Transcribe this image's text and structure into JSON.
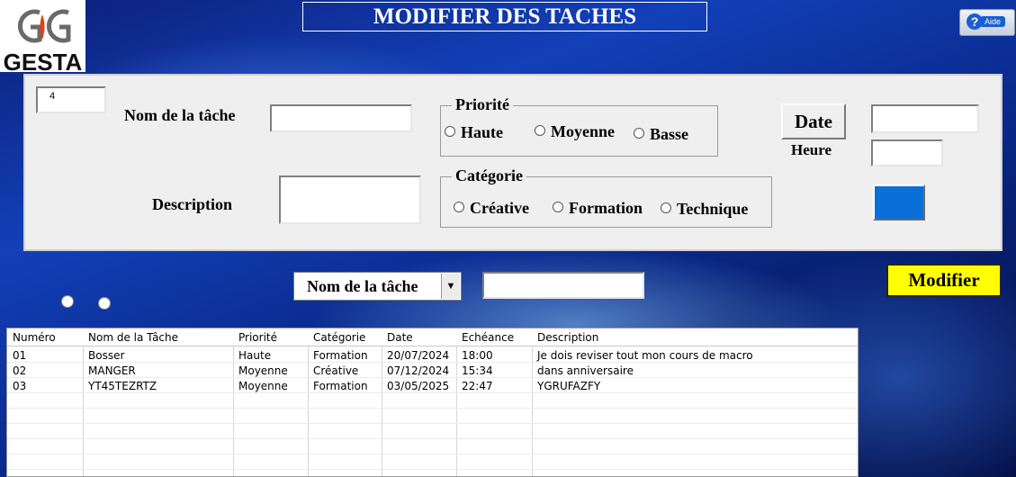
{
  "app": {
    "brand": "GESTA",
    "title": "MODIFIER DES TACHES",
    "help_label": "Aide"
  },
  "form": {
    "id_value": "4",
    "task_name_label": "Nom de la tâche",
    "task_name_value": "",
    "description_label": "Description",
    "description_value": "",
    "priority": {
      "legend": "Priorité",
      "options": [
        "Haute",
        "Moyenne",
        "Basse"
      ]
    },
    "category": {
      "legend": "Catégorie",
      "options": [
        "Créative",
        "Formation",
        "Technique"
      ]
    },
    "date_button_label": "Date",
    "date_value": "",
    "time_label": "Heure",
    "time_value": "",
    "color_swatch": "#0a6fd8"
  },
  "search": {
    "field_selected": "Nom de la tâche",
    "query_value": "",
    "modify_button_label": "Modifier"
  },
  "table": {
    "columns": [
      "Numéro",
      "Nom de la Tâche",
      "Priorité",
      "Catégorie",
      "Date",
      "Echéance",
      "Description"
    ],
    "rows": [
      [
        "01",
        "Bosser",
        "Haute",
        "Formation",
        "20/07/2024",
        "18:00",
        "Je dois reviser tout mon cours de macro"
      ],
      [
        "02",
        "MANGER",
        "Moyenne",
        "Créative",
        "07/12/2024",
        "15:34",
        "dans anniversaire"
      ],
      [
        "03",
        "YT45TEZRTZ",
        "Moyenne",
        "Formation",
        "03/05/2025",
        "22:47",
        "YGRUFAZFY"
      ]
    ]
  },
  "colors": {
    "accent": "#ffff00",
    "background": "#0a2a8c"
  }
}
